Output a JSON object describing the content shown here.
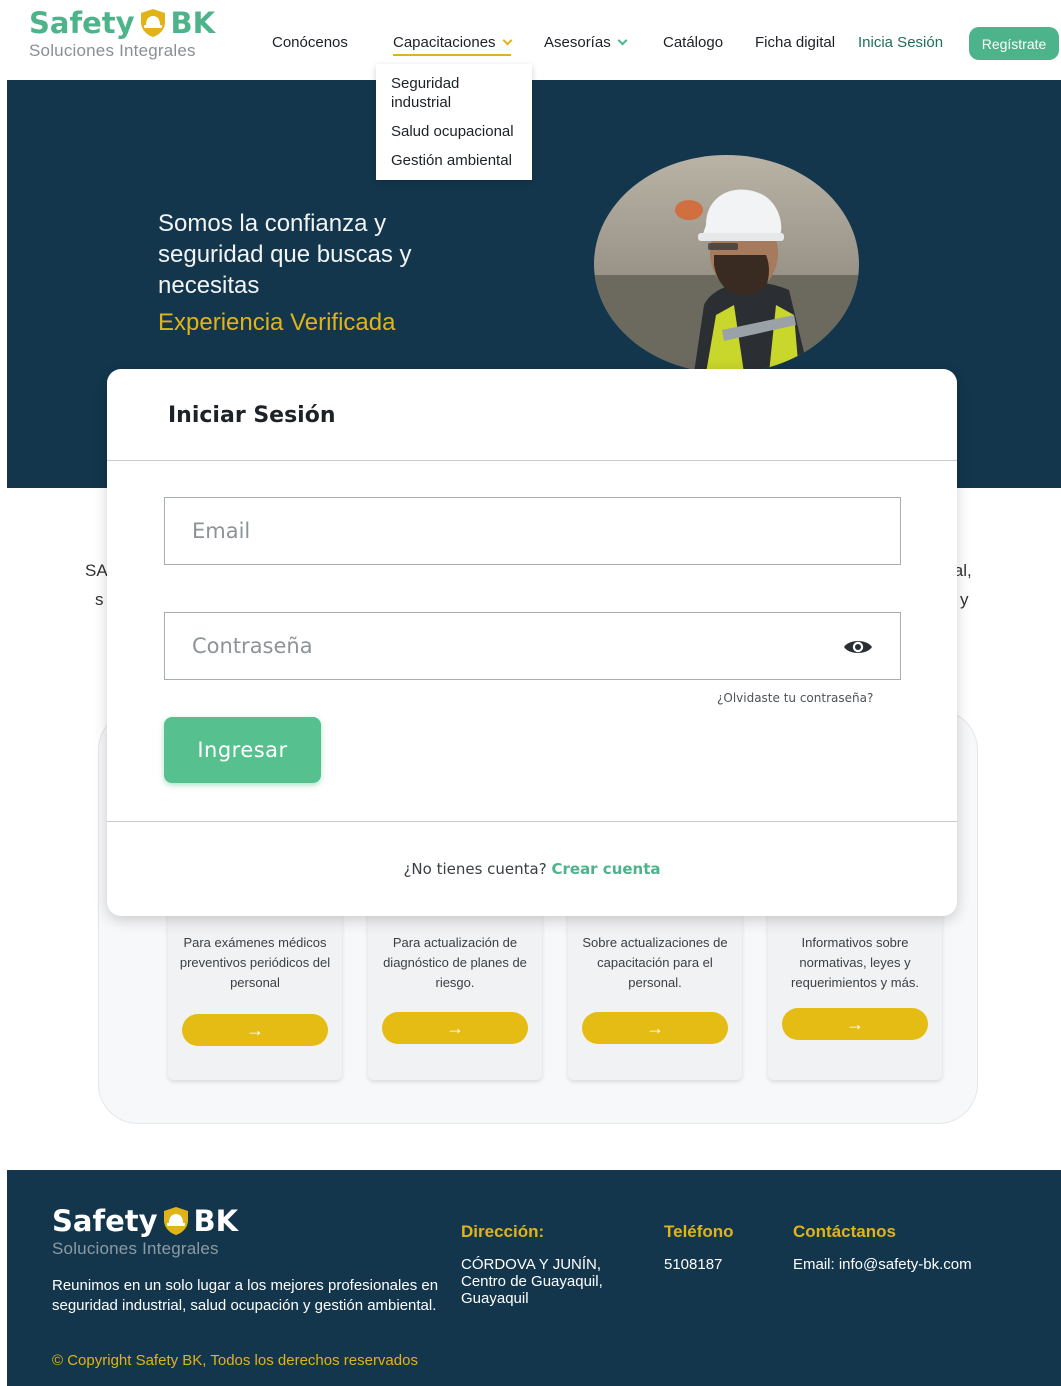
{
  "brand": {
    "name_left": "Safety",
    "name_right": "BK",
    "tagline": "Soluciones Integrales",
    "primary_color": "#4cb38a",
    "accent_color": "#e0b418",
    "dark_color": "#13364c"
  },
  "nav": {
    "items": [
      {
        "label": "Conócenos"
      },
      {
        "label": "Capacitaciones"
      },
      {
        "label": "Asesorías"
      },
      {
        "label": "Catálogo"
      },
      {
        "label": "Ficha digital"
      }
    ],
    "login_label": "Inicia Sesión",
    "register_label": "Regístrate",
    "dropdown": [
      "Seguridad industrial",
      "Salud ocupacional",
      "Gestión ambiental"
    ]
  },
  "hero": {
    "headline": "Somos la confianza y seguridad que buscas y necesitas",
    "accent": "Experiencia Verificada"
  },
  "background": {
    "intro_left_1": "SA",
    "intro_left_2": "s",
    "intro_right_1": "ial,",
    "intro_right_2": "y",
    "services": [
      {
        "description": "Para exámenes médicos preventivos periódicos del personal",
        "arrow": "→"
      },
      {
        "description": "Para actualización de diagnóstico de planes de riesgo.",
        "arrow": "→"
      },
      {
        "description": "Sobre actualizaciones de capacitación para el personal.",
        "arrow": "→"
      },
      {
        "description": "Informativos sobre normativas, leyes y requerimientos y más.",
        "arrow": "→"
      }
    ]
  },
  "modal": {
    "title": "Iniciar Sesión",
    "email_placeholder": "Email",
    "password_placeholder": "Contraseña",
    "eye_icon": "eye-icon",
    "forgot_label": "¿Olvidaste tu contraseña?",
    "submit_label": "Ingresar",
    "no_account_label": "¿No tienes cuenta?",
    "create_account_label": "Crear cuenta"
  },
  "footer": {
    "about": "Reunimos en un solo lugar a los mejores profesionales en seguridad industrial, salud ocupación y gestión ambiental.",
    "copyright": "© Copyright Safety BK,  Todos los derechos reservados",
    "address_heading": "Dirección:",
    "address_value": "CÓRDOVA Y JUNÍN,\nCentro de Guayaquil,\nGuayaquil",
    "phone_heading": "Teléfono",
    "phone_value": "5108187",
    "contact_heading": "Contáctanos",
    "contact_value": "Email: info@safety-bk.com"
  }
}
